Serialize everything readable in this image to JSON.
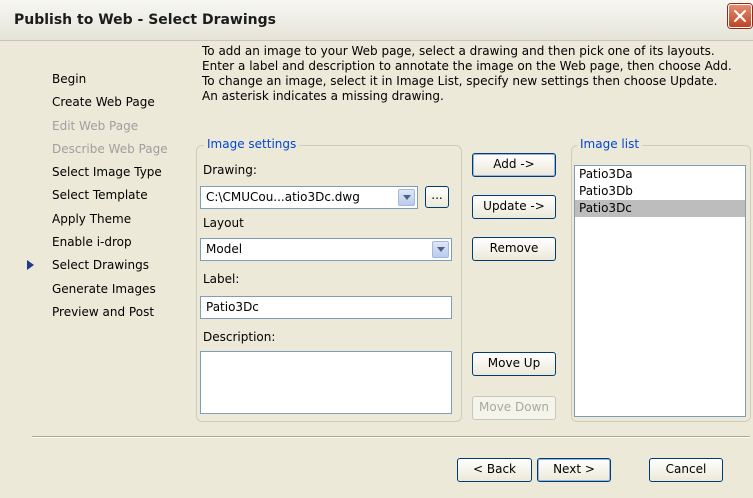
{
  "window": {
    "title": "Publish to Web - Select Drawings"
  },
  "instructions": [
    "To add an image to your Web page, select a drawing and then pick one of its layouts.",
    "Enter a label and description to annotate the image on the Web page, then choose Add.",
    "To change an image, select it in Image List, specify new settings then choose Update.",
    "An asterisk indicates a missing drawing."
  ],
  "steps": [
    {
      "label": "Begin",
      "enabled": true
    },
    {
      "label": "Create Web Page",
      "enabled": true
    },
    {
      "label": "Edit Web Page",
      "enabled": false
    },
    {
      "label": "Describe Web Page",
      "enabled": false
    },
    {
      "label": "Select Image Type",
      "enabled": true
    },
    {
      "label": "Select Template",
      "enabled": true
    },
    {
      "label": "Apply Theme",
      "enabled": true
    },
    {
      "label": "Enable i-drop",
      "enabled": true
    },
    {
      "label": "Select Drawings",
      "enabled": true,
      "current": true
    },
    {
      "label": "Generate Images",
      "enabled": true
    },
    {
      "label": "Preview and Post",
      "enabled": true
    }
  ],
  "image_settings": {
    "title": "Image settings",
    "drawing_label": "Drawing:",
    "drawing_value": "C:\\CMUCou...atio3Dc.dwg",
    "browse_label": "...",
    "layout_label": "Layout",
    "layout_value": "Model",
    "label_label": "Label:",
    "label_value": "Patio3Dc",
    "description_label": "Description:",
    "description_value": ""
  },
  "actions": {
    "add": "Add ->",
    "update": "Update ->",
    "remove": "Remove",
    "move_up": "Move Up",
    "move_down": "Move Down"
  },
  "image_list": {
    "title": "Image list",
    "items": [
      "Patio3Da",
      "Patio3Db",
      "Patio3Dc"
    ],
    "selected_index": 2
  },
  "footer": {
    "back": "< Back",
    "next": "Next >",
    "cancel": "Cancel"
  }
}
